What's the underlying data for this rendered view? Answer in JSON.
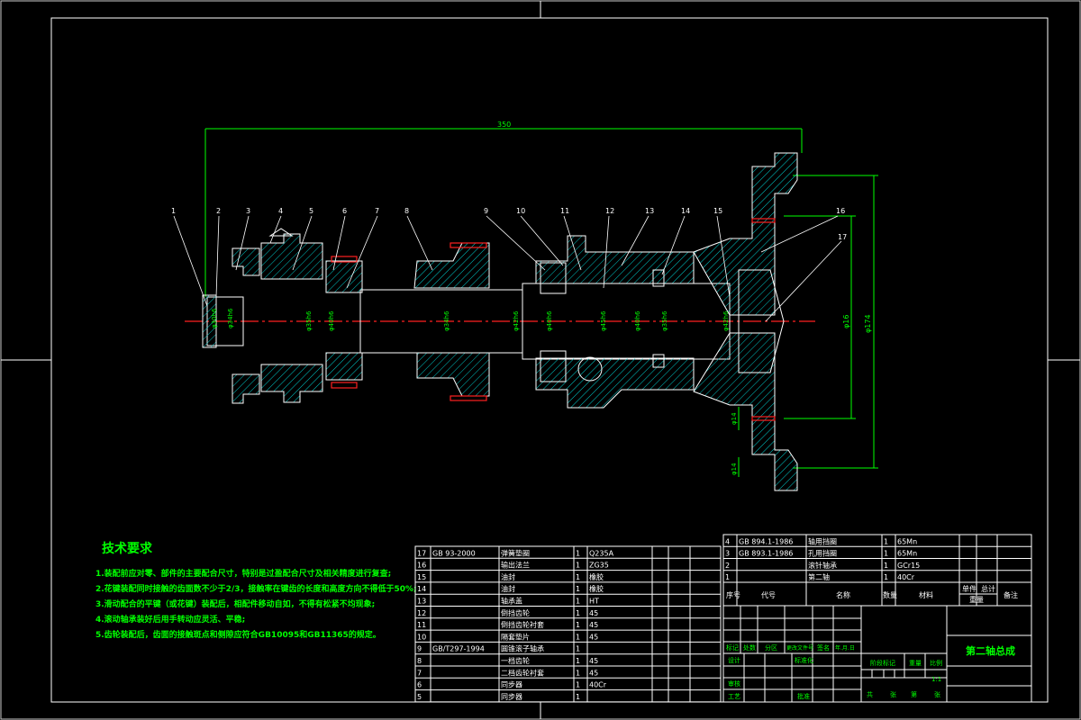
{
  "drawing": {
    "overall_length": "350",
    "dims_v": [
      "φ174",
      "φ16",
      "φ14",
      "φ14"
    ],
    "shaft_dims": [
      "φ30h6",
      "φ34h6",
      "φ35h6",
      "φ40h6",
      "φ34h6",
      "φ42h6",
      "φ40h6",
      "φ45h6",
      "φ40h6",
      "φ35h6",
      "φ42h6"
    ],
    "balloons": [
      "1",
      "2",
      "3",
      "4",
      "5",
      "6",
      "7",
      "8",
      "9",
      "10",
      "11",
      "12",
      "13",
      "14",
      "15",
      "16",
      "17"
    ]
  },
  "tech_req": {
    "title": "技术要求",
    "items": [
      "1.装配前应对零、部件的主要配合尺寸，特别是过盈配合尺寸及相关精度进行复查;",
      "2.花键装配同时接触的齿面数不少于2/3，接触率在键齿的长度和高度方向不得低于50%;",
      "3.滑动配合的平键（或花键）装配后，相配件移动自如，不得有松紧不均现象;",
      "4.滚动轴承装好后用手转动应灵活、平稳;",
      "5.齿轮装配后，齿面的接触斑点和侧隙应符合GB10095和GB11365的规定。"
    ]
  },
  "bom_lower": [
    {
      "no": "17",
      "code": "GB 93-2000",
      "name": "弹簧垫圈",
      "qty": "1",
      "mat": "Q235A"
    },
    {
      "no": "16",
      "code": "",
      "name": "输出法兰",
      "qty": "1",
      "mat": "ZG35"
    },
    {
      "no": "15",
      "code": "",
      "name": "油封",
      "qty": "1",
      "mat": "橡胶"
    },
    {
      "no": "14",
      "code": "",
      "name": "油封",
      "qty": "1",
      "mat": "橡胶"
    },
    {
      "no": "13",
      "code": "",
      "name": "轴承盖",
      "qty": "1",
      "mat": "HT"
    },
    {
      "no": "12",
      "code": "",
      "name": "倒挡齿轮",
      "qty": "1",
      "mat": "45"
    },
    {
      "no": "11",
      "code": "",
      "name": "倒挡齿轮衬套",
      "qty": "1",
      "mat": "45"
    },
    {
      "no": "10",
      "code": "",
      "name": "隔套垫片",
      "qty": "1",
      "mat": "45"
    },
    {
      "no": "9",
      "code": "GB/T297-1994",
      "name": "圆锥滚子轴承",
      "qty": "1",
      "mat": ""
    },
    {
      "no": "8",
      "code": "",
      "name": "一档齿轮",
      "qty": "1",
      "mat": "45"
    },
    {
      "no": "7",
      "code": "",
      "name": "二档齿轮衬套",
      "qty": "1",
      "mat": "45"
    },
    {
      "no": "6",
      "code": "",
      "name": "同步器",
      "qty": "1",
      "mat": "40Cr"
    },
    {
      "no": "5",
      "code": "",
      "name": "同步器",
      "qty": "1",
      "mat": ""
    }
  ],
  "bom_upper": [
    {
      "no": "4",
      "code": "GB 894.1-1986",
      "name": "轴用挡圈",
      "qty": "1",
      "mat": "65Mn"
    },
    {
      "no": "3",
      "code": "GB 893.1-1986",
      "name": "孔用挡圈",
      "qty": "1",
      "mat": "65Mn"
    },
    {
      "no": "2",
      "code": "",
      "name": "滚针轴承",
      "qty": "1",
      "mat": "GCr15"
    },
    {
      "no": "1",
      "code": "",
      "name": "第二轴",
      "qty": "1",
      "mat": "40Cr"
    }
  ],
  "bom_header": {
    "no": "序号",
    "code": "代号",
    "name": "名称",
    "qty": "数量",
    "mat": "材料",
    "single": "单件",
    "total": "总计",
    "weight": "重量",
    "remark": "备注"
  },
  "title_block": {
    "title": "第二轴总成",
    "mark": "标记",
    "count": "处数",
    "zone": "分区",
    "change_doc": "更改文件号",
    "sign": "签名",
    "date": "年.月.日",
    "design": "设计",
    "standard": "标准化",
    "review": "审核",
    "process": "工艺",
    "approve": "批准",
    "stage": "阶段标记",
    "weight": "重量",
    "scale": "比例",
    "scale_value": "1:1",
    "sheets_total": "共",
    "sheets_unit": "张",
    "sheet_no": "第",
    "sheet_unit2": "张"
  }
}
